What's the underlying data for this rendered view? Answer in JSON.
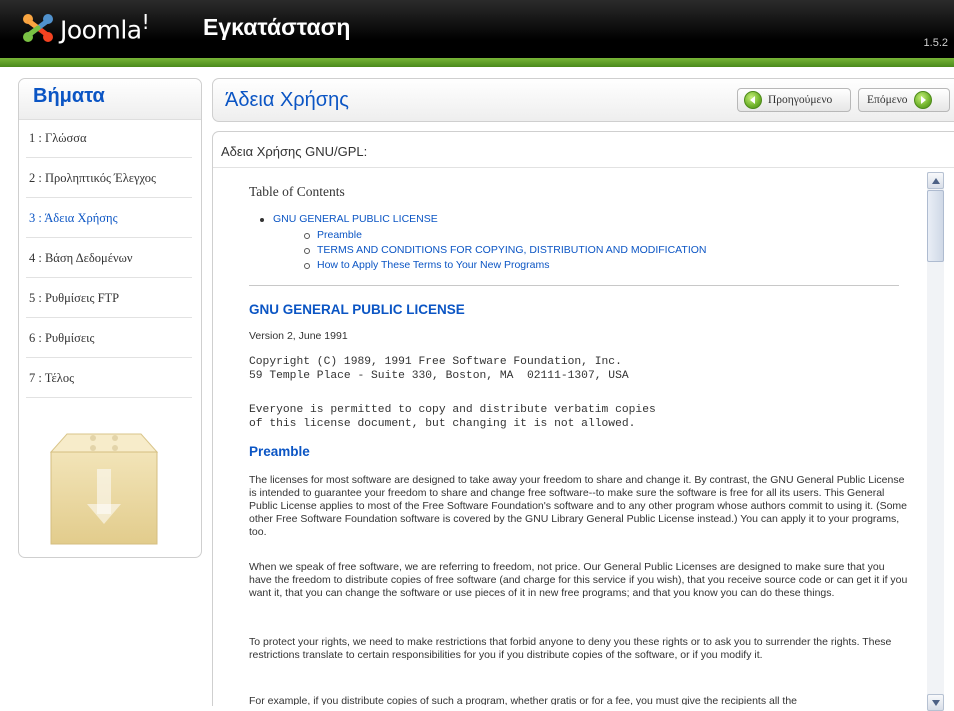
{
  "header": {
    "brand": "Joomla",
    "brand_mark": "!",
    "title": "Εγκατάσταση",
    "version": "1.5.2"
  },
  "steps": {
    "title": "Βήματα",
    "items": [
      {
        "label": "1 : Γλώσσα"
      },
      {
        "label": "2 : Προληπτικός Έλεγχος"
      },
      {
        "label": "3 : Άδεια Χρήσης"
      },
      {
        "label": "4 : Βάση Δεδομένων"
      },
      {
        "label": "5 : Ρυθμίσεις FTP"
      },
      {
        "label": "6 : Ρυθμίσεις"
      },
      {
        "label": "7 : Τέλος"
      }
    ],
    "active_index": 2
  },
  "main": {
    "title": "Άδεια Χρήσης",
    "prev_label": "Προηγούμενο",
    "next_label": "Επόμενο"
  },
  "license": {
    "title": "Αδεια Χρήσης GNU/GPL:",
    "toc_title": "Table of Contents",
    "toc_main": "GNU GENERAL PUBLIC LICENSE",
    "toc_sub": [
      "Preamble",
      "TERMS AND CONDITIONS FOR COPYING, DISTRIBUTION AND MODIFICATION",
      "How to Apply These Terms to Your New Programs"
    ],
    "heading": "GNU GENERAL PUBLIC LICENSE",
    "version": "Version 2, June 1991",
    "copyright_1": "Copyright (C) 1989, 1991 Free Software Foundation, Inc.",
    "copyright_2": "59 Temple Place - Suite 330, Boston, MA  02111-1307, USA",
    "permission_1": "Everyone is permitted to copy and distribute verbatim copies",
    "permission_2": "of this license document, but changing it is not allowed.",
    "preamble_heading": "Preamble",
    "para1": "The licenses for most software are designed to take away your freedom to share and change it. By contrast, the GNU General Public License is intended to guarantee your freedom to share and change free software--to make sure the software is free for all its users. This General Public License applies to most of the Free Software Foundation's software and to any other program whose authors commit to using it. (Some other Free Software Foundation software is covered by the GNU Library General Public License instead.) You can apply it to your programs, too.",
    "para2": "When we speak of free software, we are referring to freedom, not price. Our General Public Licenses are designed to make sure that you have the freedom to distribute copies of free software (and charge for this service if you wish), that you receive source code or can get it if you want it, that you can change the software or use pieces of it in new free programs; and that you know you can do these things.",
    "para3": "To protect your rights, we need to make restrictions that forbid anyone to deny you these rights or to ask you to surrender the rights. These restrictions translate to certain responsibilities for you if you distribute copies of the software, or if you modify it.",
    "para4": "For example, if you distribute copies of such a program, whether gratis or for a fee, you must give the recipients all the"
  },
  "colors": {
    "accent": "#0b55c4",
    "green": "#6fb22a",
    "header_bg": "#000000"
  },
  "icons": [
    "joomla-logo-icon",
    "install-box-icon",
    "prev-arrow-icon",
    "next-arrow-icon",
    "scroll-up-icon",
    "scroll-down-icon"
  ]
}
